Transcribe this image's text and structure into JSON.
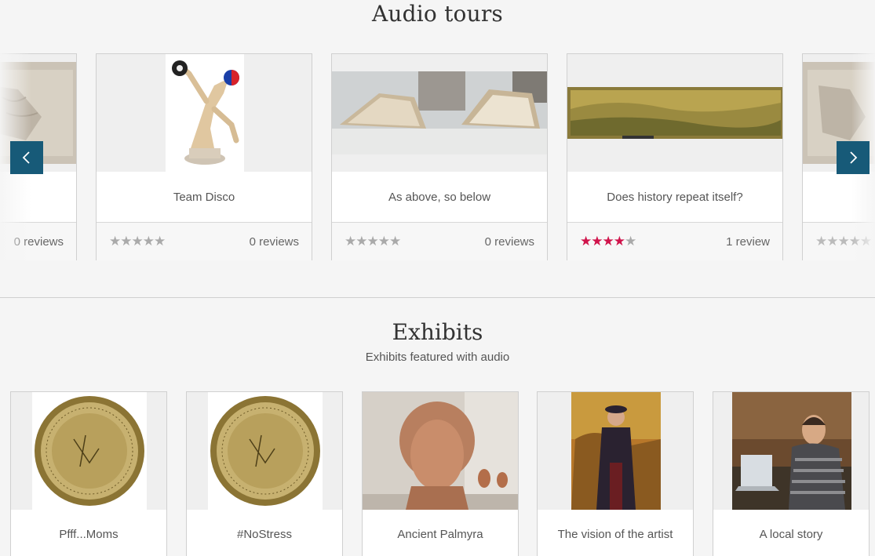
{
  "audio_tours": {
    "title": "Audio tours",
    "cards": [
      {
        "title": "",
        "reviews": "0 reviews",
        "rating": 0
      },
      {
        "title": "Team Disco",
        "reviews": "0 reviews",
        "rating": 0
      },
      {
        "title": "As above, so below",
        "reviews": "0 reviews",
        "rating": 0
      },
      {
        "title": "Does history repeat itself?",
        "reviews": "1 review",
        "rating": 4
      },
      {
        "title": "",
        "reviews": "",
        "rating": 0
      }
    ],
    "prev_icon": "chevron-left-icon",
    "next_icon": "chevron-right-icon"
  },
  "exhibits": {
    "title": "Exhibits",
    "subtitle": "Exhibits featured with audio",
    "cards": [
      {
        "title": "Pfff...Moms"
      },
      {
        "title": "#NoStress"
      },
      {
        "title": "Ancient Palmyra"
      },
      {
        "title": "The vision of the artist"
      },
      {
        "title": "A local story"
      }
    ]
  },
  "colors": {
    "nav_button": "#175a78",
    "star_active": "#d0144b",
    "star_inactive": "#aaaaaa"
  }
}
